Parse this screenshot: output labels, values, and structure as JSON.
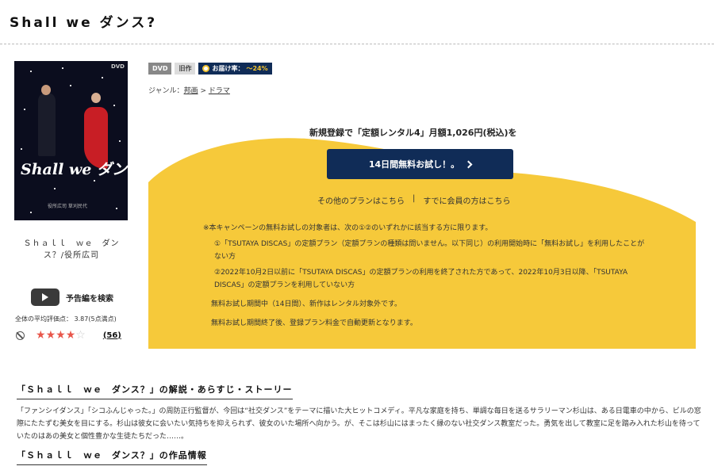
{
  "page": {
    "title": "Shall we ダンス?"
  },
  "sidebar": {
    "product_name": "Ｓｈａｌｌ　ｗｅ　ダンス？/役所広司",
    "jacket": {
      "dvd_label": "DVD",
      "logo_text": "Shall we ダンス?",
      "cast_text": "役所広司 草刈民代"
    },
    "trailer_label": "予告編を検索",
    "avg_rating_text": "全体の平均評価点： 3.87(5点満点)",
    "rating_value": 3.87,
    "stars_filled": 4,
    "stars_total": 5,
    "review_count": "(56)"
  },
  "badges": {
    "dvd": "DVD",
    "old": "旧作",
    "delivery_label": "お届け率：",
    "delivery_rate": "～24%"
  },
  "genre": {
    "prefix": "ジャンル：",
    "level1": "邦画",
    "sep": " > ",
    "level2": "ドラマ"
  },
  "cta": {
    "headline": "新規登録で「定額レンタル4」月額1,026円(税込)を",
    "button_label": "14日間無料お試し！。",
    "other_plans": "その他のプランはこちら",
    "divider": "|",
    "members": "すでに会員の方はこちら",
    "accent_color": "#f6c93a",
    "button_color": "#102c57"
  },
  "notes": {
    "intro": "※本キャンペーンの無料お試しの対象者は、次の①②のいずれかに該当する方に限ります。",
    "item1": "①「TSUTAYA DISCAS」の定額プラン（定額プランの種類は問いません。以下同じ）の利用開始時に「無料お試し」を利用したことがない方",
    "item2": "②2022年10月2日以前に「TSUTAYA DISCAS」の定額プランの利用を終了された方であって、2022年10月3日以降、「TSUTAYA DISCAS」の定額プランを利用していない方",
    "line3": "無料お試し期間中（14日間）、新作はレンタル対象外です。",
    "line4": "無料お試し期間終了後、登録プラン料金で自動更新となります。"
  },
  "story": {
    "heading": "「Ｓｈａｌｌ　ｗｅ　ダンス？」の解説・あらすじ・ストーリー",
    "text": "「ファンシイダンス」「シコふんじゃった。」の周防正行監督が、今回は“社交ダンス”をテーマに描いた大ヒットコメディ。平凡な家庭を持ち、単調な毎日を送るサラリーマン杉山は、ある日電車の中から、ビルの窓際にたたずむ美女を目にする。杉山は彼女に会いたい気持ちを抑えられず、彼女のいた場所へ向かう。が、そこは杉山にはまったく縁のない社交ダンス教室だった。勇気を出して教室に足を踏み入れた杉山を待っていたのはあの美女と個性豊かな生徒たちだった……。"
  },
  "info": {
    "heading": "「Ｓｈａｌｌ　ｗｅ　ダンス？」の作品情報"
  }
}
